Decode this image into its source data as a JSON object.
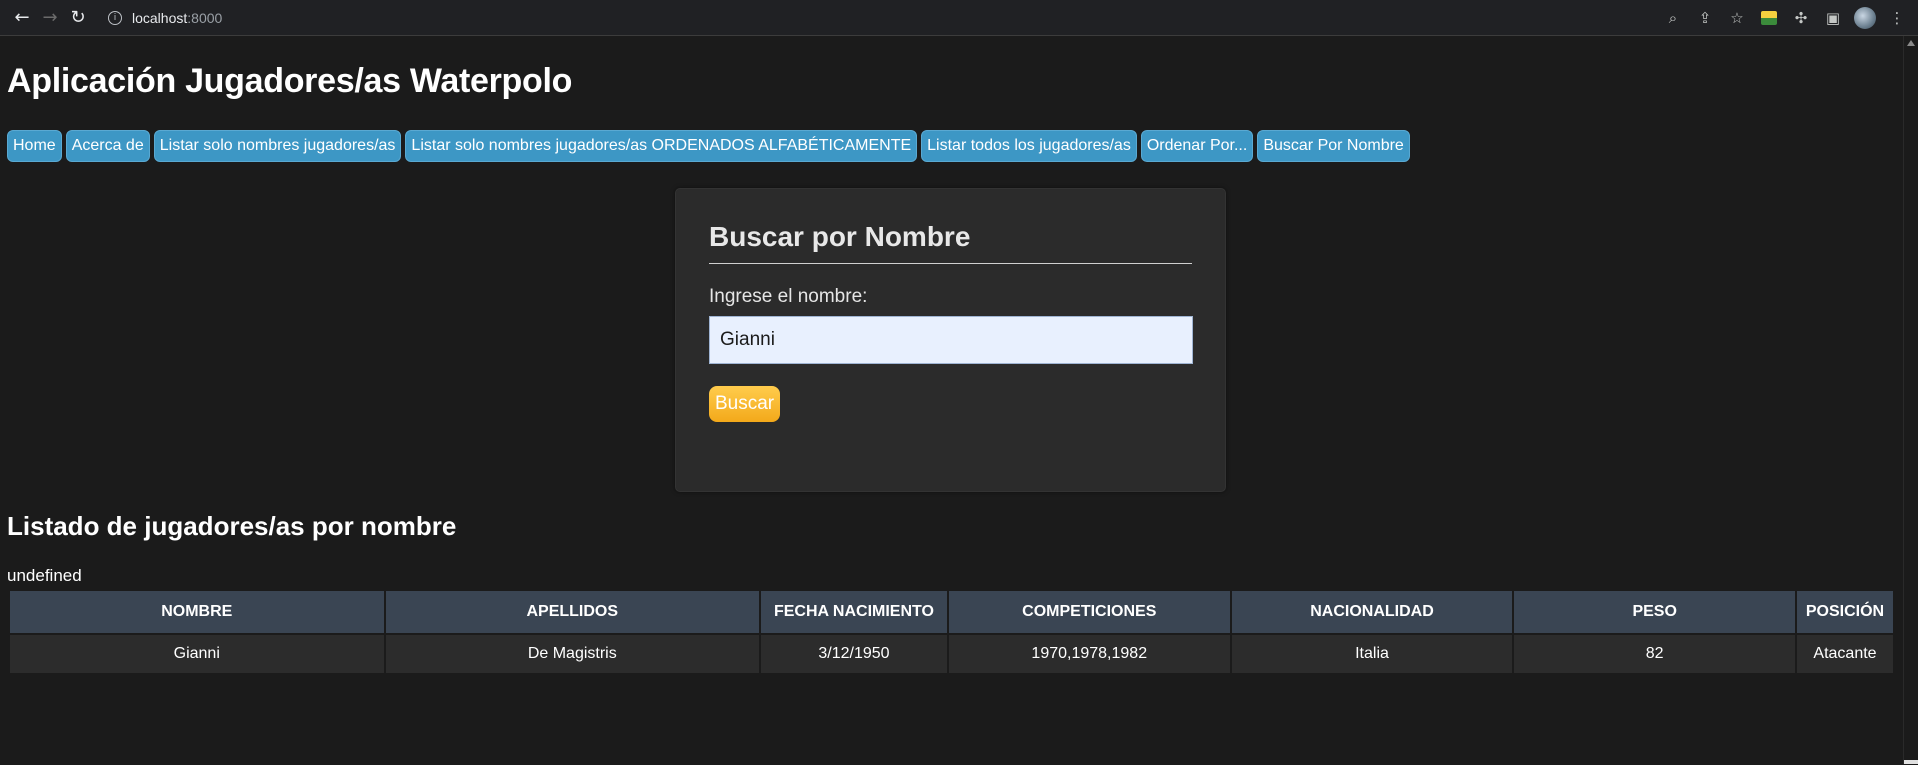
{
  "browser": {
    "url_host": "localhost",
    "url_port": ":8000"
  },
  "app_title": "Aplicación Jugadores/as Waterpolo",
  "menu": [
    {
      "label": "Home"
    },
    {
      "label": "Acerca de"
    },
    {
      "label": "Listar solo nombres jugadores/as"
    },
    {
      "label": "Listar solo nombres jugadores/as ORDENADOS ALFABÉTICAMENTE"
    },
    {
      "label": "Listar todos los jugadores/as"
    },
    {
      "label": "Ordenar Por..."
    },
    {
      "label": "Buscar Por Nombre"
    }
  ],
  "search_form": {
    "title": "Buscar por Nombre",
    "label": "Ingrese el nombre:",
    "value": "Gianni",
    "button": "Buscar"
  },
  "results": {
    "title": "Listado de jugadores/as por nombre",
    "status": "undefined",
    "columns": [
      "NOMBRE",
      "APELLIDOS",
      "FECHA NACIMIENTO",
      "COMPETICIONES",
      "NACIONALIDAD",
      "PESO",
      "POSICIÓN"
    ],
    "rows": [
      [
        "Gianni",
        "De Magistris",
        "3/12/1950",
        "1970,1978,1982",
        "Italia",
        "82",
        "Atacante"
      ]
    ]
  },
  "colors": {
    "menu_button": "#3d97c5",
    "search_button": "#f3a91a",
    "table_header": "#3a4553"
  }
}
